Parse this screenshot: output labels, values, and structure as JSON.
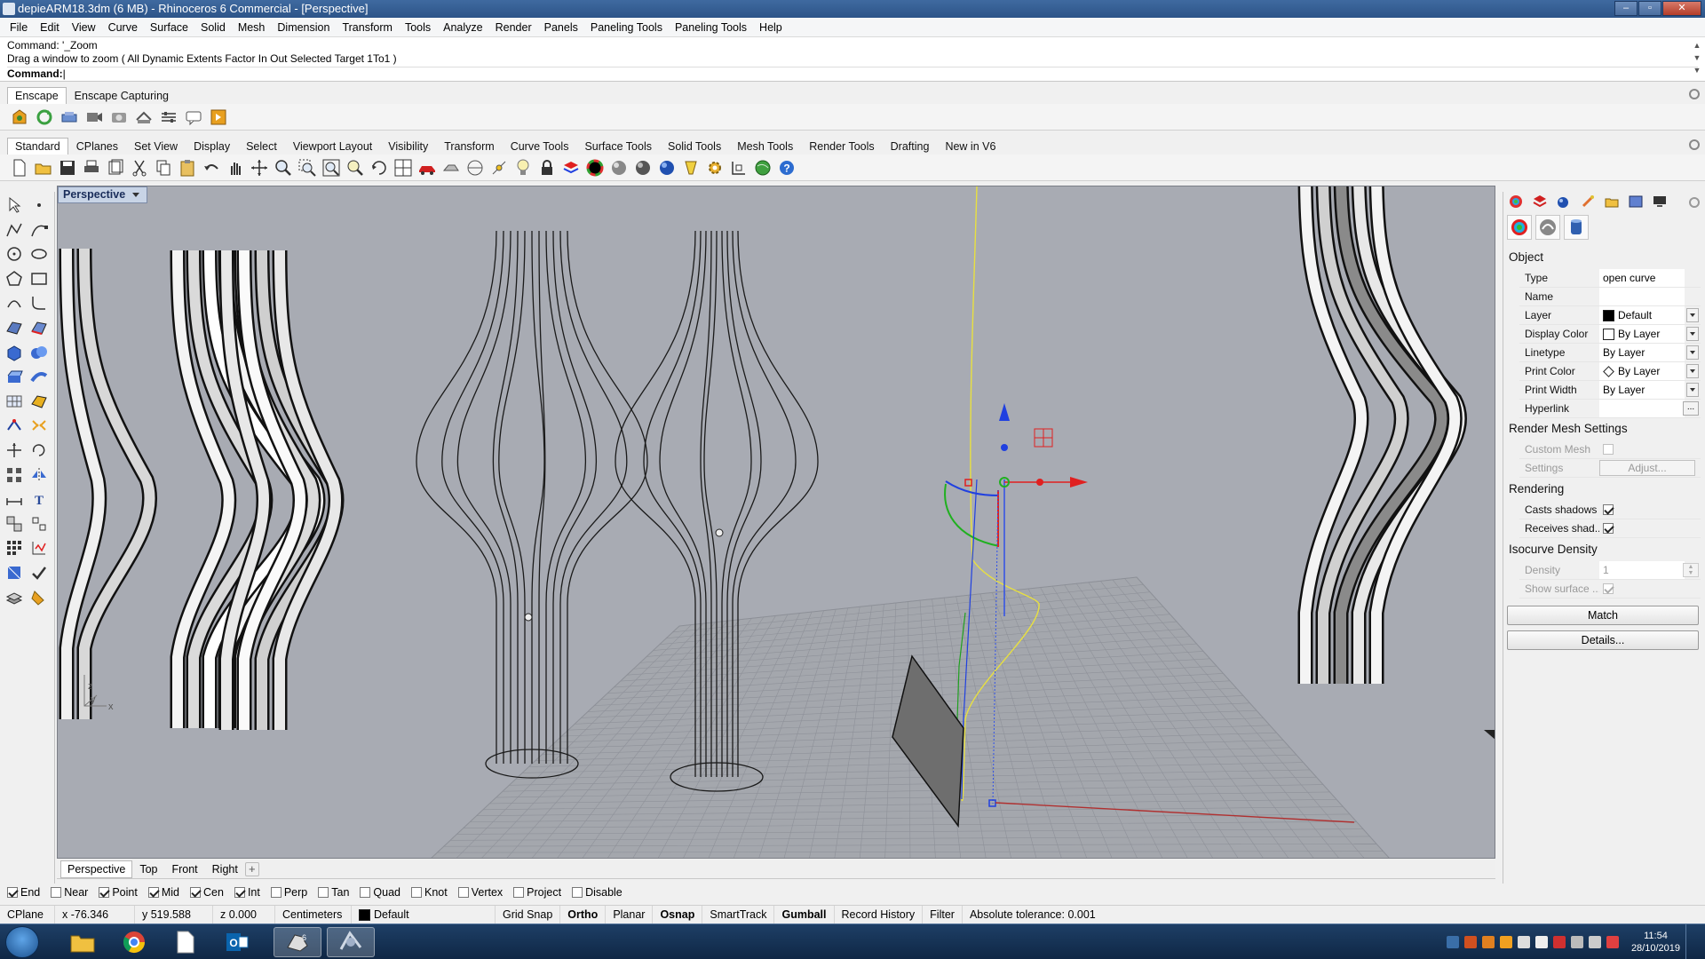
{
  "window": {
    "title": "depieARM18.3dm (6 MB) - Rhinoceros 6 Commercial - [Perspective]",
    "controls": [
      "–",
      "▫",
      "✕"
    ]
  },
  "menu": [
    "File",
    "Edit",
    "View",
    "Curve",
    "Surface",
    "Solid",
    "Mesh",
    "Dimension",
    "Transform",
    "Tools",
    "Analyze",
    "Render",
    "Panels",
    "Paneling Tools",
    "Paneling Tools",
    "Help"
  ],
  "command": {
    "history1": "Command: '_Zoom",
    "history2": "Drag a window to zoom ( All  Dynamic  Extents  Factor  In  Out  Selected  Target  1To1 )",
    "prompt": "Command:"
  },
  "enscape": {
    "tabs": [
      "Enscape",
      "Enscape Capturing"
    ]
  },
  "standard_tabs": [
    "Standard",
    "CPlanes",
    "Set View",
    "Display",
    "Select",
    "Viewport Layout",
    "Visibility",
    "Transform",
    "Curve Tools",
    "Surface Tools",
    "Solid Tools",
    "Mesh Tools",
    "Render Tools",
    "Drafting",
    "New in V6"
  ],
  "viewport": {
    "label": "Perspective",
    "axis_z": "z",
    "axis_y": "y",
    "axis_x": "x"
  },
  "viewport_tabs": [
    "Perspective",
    "Top",
    "Front",
    "Right"
  ],
  "properties": {
    "object_title": "Object",
    "type_label": "Type",
    "type_value": "open curve",
    "name_label": "Name",
    "name_value": "",
    "layer_label": "Layer",
    "layer_value": "Default",
    "display_color_label": "Display Color",
    "display_color_value": "By Layer",
    "linetype_label": "Linetype",
    "linetype_value": "By Layer",
    "print_color_label": "Print Color",
    "print_color_value": "By Layer",
    "print_width_label": "Print Width",
    "print_width_value": "By Layer",
    "hyperlink_label": "Hyperlink",
    "hyperlink_btn": "...",
    "render_mesh_title": "Render Mesh Settings",
    "custom_mesh_label": "Custom Mesh",
    "settings_label": "Settings",
    "adjust_btn": "Adjust...",
    "rendering_title": "Rendering",
    "casts_shadows_label": "Casts shadows",
    "receives_shadows_label": "Receives shad...",
    "isocurve_title": "Isocurve Density",
    "density_label": "Density",
    "density_value": "1",
    "show_surface_label": "Show surface ...",
    "match_btn": "Match",
    "details_btn": "Details..."
  },
  "osnap": [
    {
      "label": "End",
      "checked": true
    },
    {
      "label": "Near",
      "checked": false
    },
    {
      "label": "Point",
      "checked": true
    },
    {
      "label": "Mid",
      "checked": true
    },
    {
      "label": "Cen",
      "checked": true
    },
    {
      "label": "Int",
      "checked": true
    },
    {
      "label": "Perp",
      "checked": false
    },
    {
      "label": "Tan",
      "checked": false
    },
    {
      "label": "Quad",
      "checked": false
    },
    {
      "label": "Knot",
      "checked": false
    },
    {
      "label": "Vertex",
      "checked": false
    },
    {
      "label": "Project",
      "checked": false
    },
    {
      "label": "Disable",
      "checked": false
    }
  ],
  "status": {
    "cplane": "CPlane",
    "x": "x -76.346",
    "y": "y 519.588",
    "z": "z 0.000",
    "units": "Centimeters",
    "layer": "Default",
    "grid_snap": "Grid Snap",
    "ortho": "Ortho",
    "planar": "Planar",
    "osnap": "Osnap",
    "smarttrack": "SmartTrack",
    "gumball": "Gumball",
    "record_history": "Record History",
    "filter": "Filter",
    "tolerance": "Absolute tolerance: 0.001"
  },
  "taskbar": {
    "time": "11:54",
    "date": "28/10/2019"
  },
  "colors": {
    "viewport_bg": "#a8abb3",
    "titlebar": "#2d5488",
    "gumball_x": "#e02020",
    "gumball_y": "#20b020",
    "gumball_z": "#2040e0",
    "selected_curve": "#e8e040"
  }
}
